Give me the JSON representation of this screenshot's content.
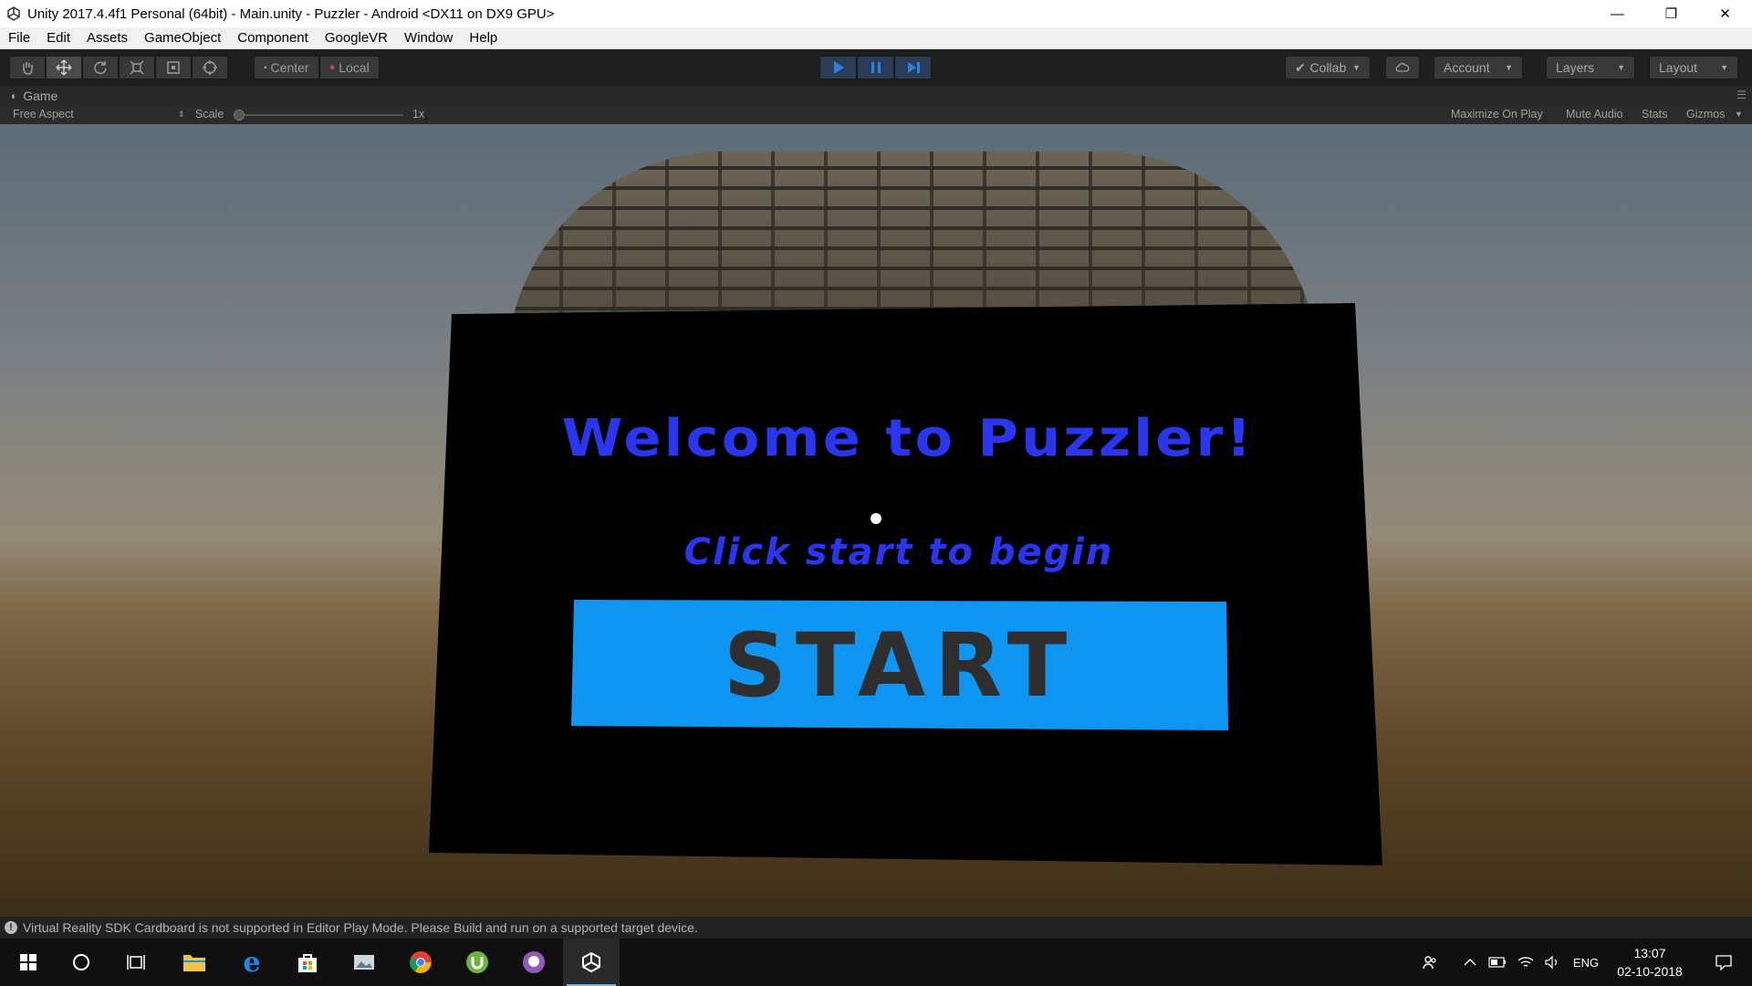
{
  "window": {
    "title": "Unity 2017.4.4f1 Personal (64bit) - Main.unity - Puzzler - Android <DX11 on DX9 GPU>",
    "minimize_glyph": "—",
    "restore_glyph": "❐",
    "close_glyph": "✕"
  },
  "menu": [
    "File",
    "Edit",
    "Assets",
    "GameObject",
    "Component",
    "GoogleVR",
    "Window",
    "Help"
  ],
  "toolbar": {
    "pivot_label": "Center",
    "space_label": "Local",
    "collab_label": "Collab",
    "account_label": "Account",
    "layers_label": "Layers",
    "layout_label": "Layout"
  },
  "game_view": {
    "tab_label": "Game",
    "aspect": "Free Aspect",
    "scale_label": "Scale",
    "scale_value": "1x",
    "maximize_on_play": "Maximize On Play",
    "mute_audio": "Mute Audio",
    "stats": "Stats",
    "gizmos": "Gizmos"
  },
  "scene": {
    "welcome_text": "Welcome to Puzzler!",
    "subtitle_text": "Click start to begin",
    "start_label": "START",
    "accent_blue": "#2a35f0",
    "button_blue": "#0e96f2"
  },
  "status": {
    "message": "Virtual Reality SDK Cardboard is not supported in Editor Play Mode. Please Build and run on a supported target device."
  },
  "taskbar": {
    "language": "ENG",
    "time": "13:07",
    "date": "02-10-2018"
  }
}
